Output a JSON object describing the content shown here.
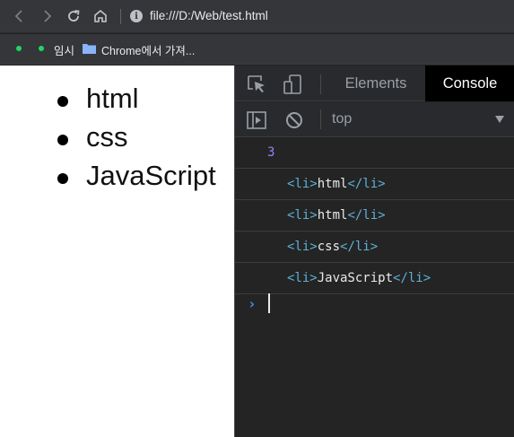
{
  "browser": {
    "url": "file:///D:/Web/test.html",
    "icons": [
      "back-icon",
      "forward-icon",
      "reload-icon",
      "home-icon",
      "info-icon"
    ]
  },
  "bookmarks": [
    {
      "label": "임시"
    },
    {
      "label": "Chrome에서 가져..."
    }
  ],
  "page": {
    "list": [
      "html",
      "css",
      "JavaScript"
    ]
  },
  "devtools": {
    "tabs": [
      "Elements",
      "Console"
    ],
    "active_tab": "Console",
    "context": "top",
    "console": {
      "result": "3",
      "entries": [
        {
          "open": "<li>",
          "text": "html",
          "close": "</li>"
        },
        {
          "open": "<li>",
          "text": "html",
          "close": "</li>"
        },
        {
          "open": "<li>",
          "text": "css",
          "close": "</li>"
        },
        {
          "open": "<li>",
          "text": "JavaScript",
          "close": "</li>"
        }
      ],
      "prompt": "›"
    },
    "colors": {
      "tag": "#5db0d7",
      "number": "#9980ff",
      "prompt": "#4c8df6"
    }
  }
}
